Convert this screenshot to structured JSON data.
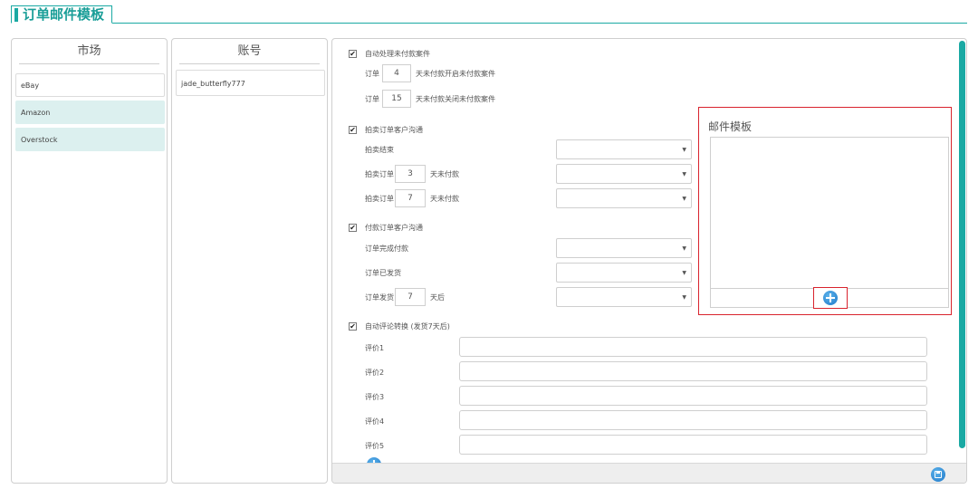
{
  "page": {
    "title": "订单邮件模板"
  },
  "markets": {
    "header": "市场",
    "items": [
      {
        "label": "eBay"
      },
      {
        "label": "Amazon"
      },
      {
        "label": "Overstock"
      }
    ]
  },
  "accounts": {
    "header": "账号",
    "items": [
      {
        "label": "jade_butterfly777"
      }
    ]
  },
  "unpaid_case": {
    "checkbox_label": "自动处理未付款案件",
    "checked": true,
    "open_prefix": "订单",
    "open_days": "4",
    "open_suffix": "天未付款开启未付款案件",
    "close_prefix": "订单",
    "close_days": "15",
    "close_suffix": "天未付款关闭未付款案件"
  },
  "auction": {
    "checkbox_label": "拍卖订单客户沟通",
    "checked": true,
    "end_label": "拍卖结束",
    "unpaid1_prefix": "拍卖订单",
    "unpaid1_days": "3",
    "unpaid1_suffix": "天未付款",
    "unpaid2_prefix": "拍卖订单",
    "unpaid2_days": "7",
    "unpaid2_suffix": "天未付款"
  },
  "paid": {
    "checkbox_label": "付款订单客户沟通",
    "checked": true,
    "complete_label": "订单完成付款",
    "shipped_label": "订单已发货",
    "after_prefix": "订单发货",
    "after_days": "7",
    "after_suffix": "天后"
  },
  "feedback": {
    "checkbox_label": "自动评论转换 (发货7天后)",
    "checked": true,
    "items": [
      {
        "label": "评价1"
      },
      {
        "label": "评价2"
      },
      {
        "label": "评价3"
      },
      {
        "label": "评价4"
      },
      {
        "label": "评价5"
      }
    ]
  },
  "template_box": {
    "title": "邮件模板"
  },
  "icons": {
    "check": "✔",
    "dropdown": "▼",
    "add": "plus-circle-icon",
    "save": "save-icon"
  },
  "colors": {
    "accent": "#1aa9a3",
    "highlight": "#d9232d",
    "selected": "#dcf0ef",
    "icon_blue": "#1f78c8"
  }
}
